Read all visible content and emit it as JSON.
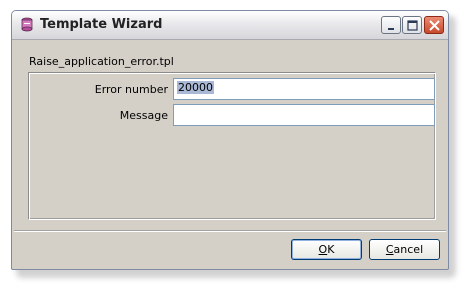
{
  "window": {
    "title": "Template Wizard",
    "controls": {
      "minimize": "minimize-icon",
      "maximize": "maximize-icon",
      "close": "close-icon"
    }
  },
  "template_file": "Raise_application_error.tpl",
  "form": {
    "error_number": {
      "label": "Error number",
      "value": "20000"
    },
    "message": {
      "label": "Message",
      "value": ""
    }
  },
  "buttons": {
    "ok": {
      "accel": "O",
      "rest": "K"
    },
    "cancel": {
      "accel": "C",
      "rest": "ancel"
    }
  },
  "colors": {
    "selection": "#a9b8d4",
    "close_button": "#c8492d",
    "focus_border": "#91b1e0"
  }
}
